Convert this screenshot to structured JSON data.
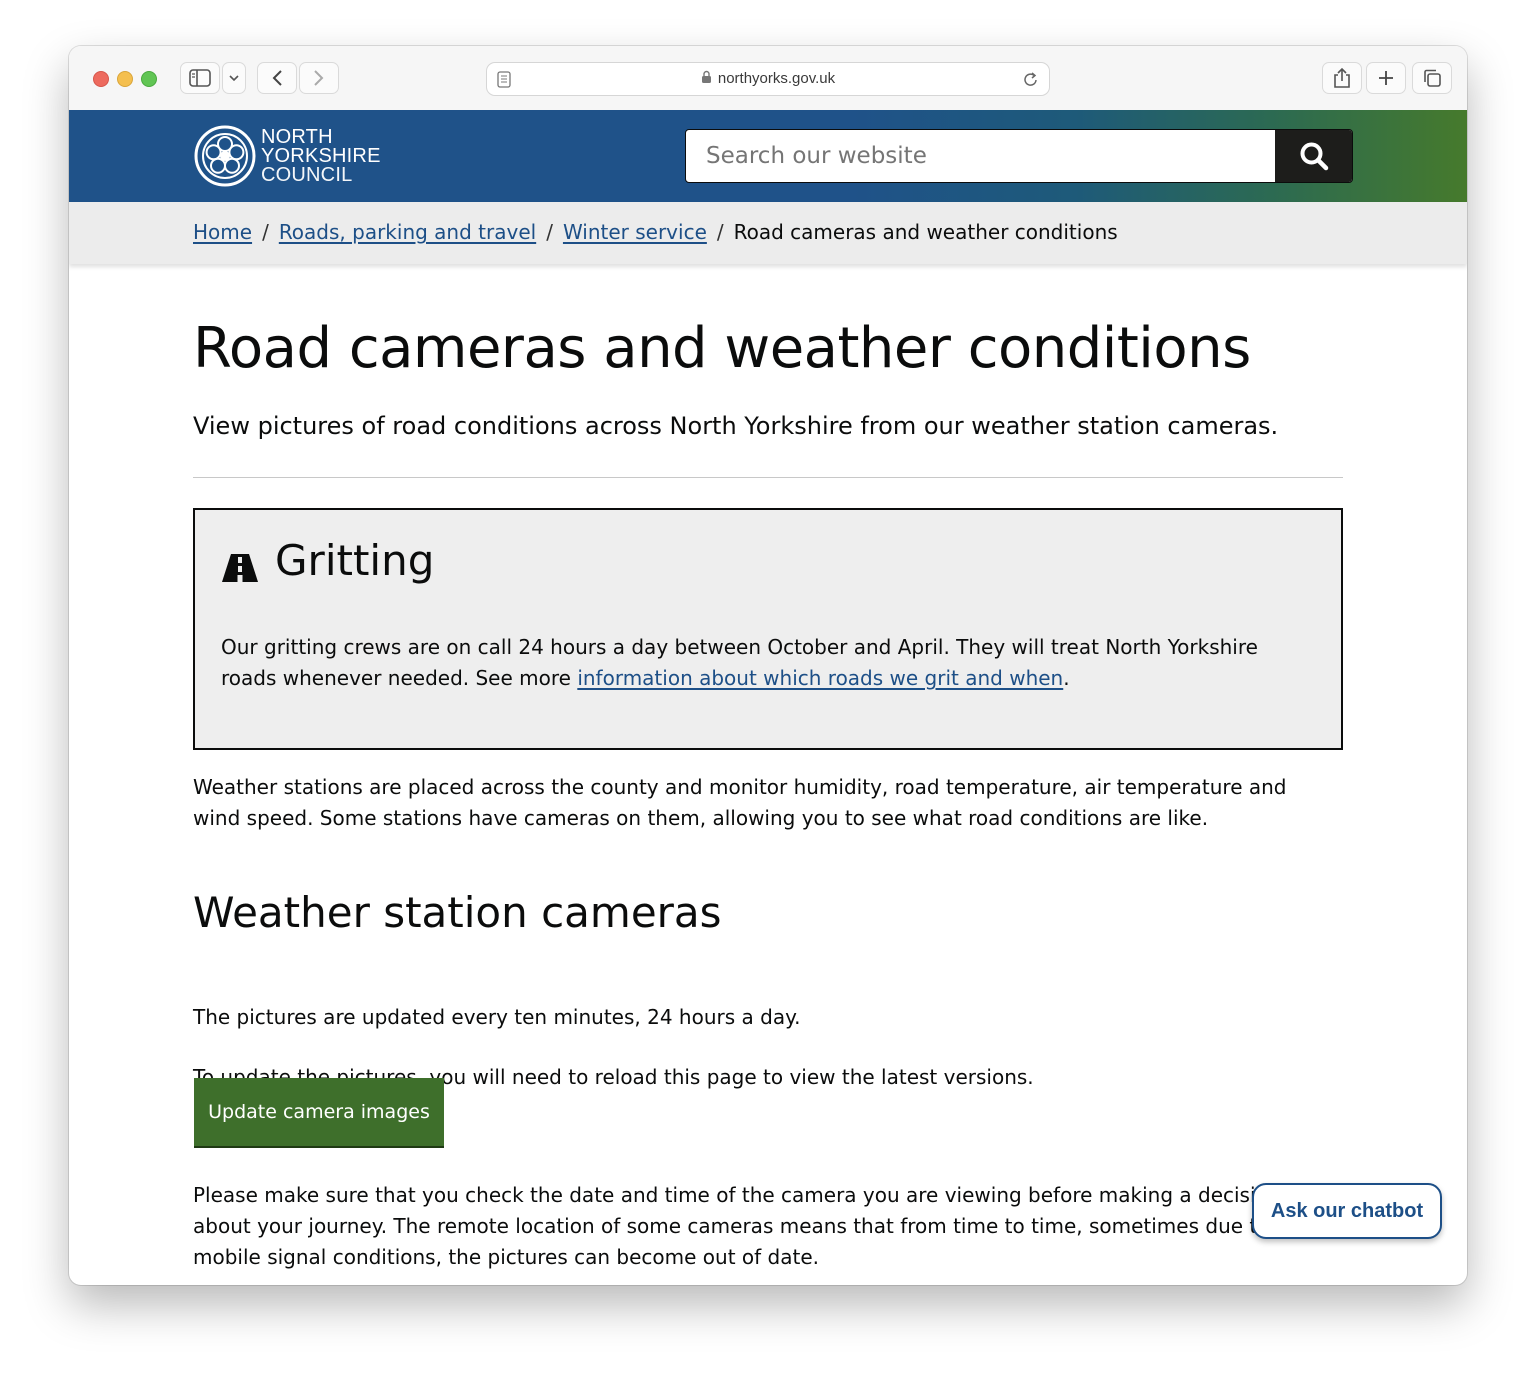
{
  "browser": {
    "url": "northyorks.gov.uk"
  },
  "header": {
    "logo_line1": "NORTH",
    "logo_line2": "YORKSHIRE",
    "logo_line3": "COUNCIL",
    "search_placeholder": "Search our website"
  },
  "breadcrumb": {
    "items": [
      "Home",
      "Roads, parking and travel",
      "Winter service"
    ],
    "current": "Road cameras and weather conditions",
    "separator": "/"
  },
  "page": {
    "title": "Road cameras and weather conditions",
    "lead": "View pictures of road conditions across North Yorkshire from our weather station cameras."
  },
  "callout": {
    "icon": "road-icon",
    "title": "Gritting",
    "text_before": "Our gritting crews are on call 24 hours a day between October and April. They will treat North Yorkshire roads whenever needed. See more ",
    "link_text": "information about which roads we grit and when",
    "text_after": "."
  },
  "intro": "Weather stations are placed across the county and monitor humidity, road temperature, air temperature and wind speed. Some stations have cameras on them, allowing you to see what road conditions are like.",
  "cameras": {
    "heading": "Weather station cameras",
    "para1": "The pictures are updated every ten minutes, 24 hours a day.",
    "para2": "To update the pictures, you will need to reload this page to view the latest versions.",
    "button_label": "Update camera images",
    "para3": "Please make sure that you check the date and time of the camera you are viewing before making a decision about your journey. The remote location of some cameras means that from time to time, sometimes due to mobile signal conditions, the pictures can become out of date."
  },
  "chatbot": {
    "label": "Ask our chatbot"
  },
  "colors": {
    "header_blue": "#1f5289",
    "header_green": "#467a2c",
    "link": "#1d4f87",
    "button_green": "#3e6f2b",
    "callout_bg": "#eeeeee"
  }
}
